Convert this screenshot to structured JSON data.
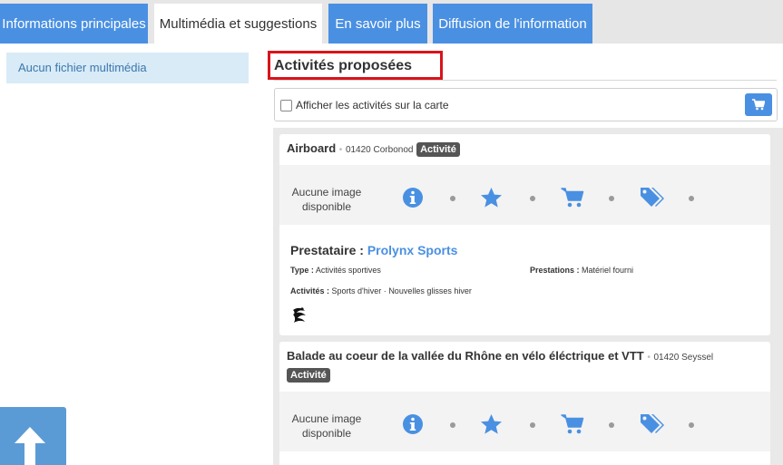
{
  "tabs": [
    {
      "label": "Informations principales"
    },
    {
      "label": "Multimédia et suggestions"
    },
    {
      "label": "En savoir plus"
    },
    {
      "label": "Diffusion de l'information"
    }
  ],
  "sidebar": {
    "media_empty": "Aucun fichier multimédia"
  },
  "section": {
    "title": "Activités proposées"
  },
  "map_toggle": {
    "label": "Afficher les activités sur la carte",
    "checked": false
  },
  "activities": [
    {
      "name": "Airboard",
      "separator": "•",
      "location": "01420 Corbonod",
      "badge": "Activité",
      "no_image": "Aucune image disponible",
      "provider_label": "Prestataire :",
      "provider_name": "Prolynx Sports",
      "type_label": "Type :",
      "type_value": "Activités sportives",
      "prestations_label": "Prestations :",
      "prestations_value": "Matériel fourni",
      "activites_label": "Activités :",
      "activites_values": [
        "Sports d'hiver",
        "Nouvelles glisses hiver"
      ],
      "activites_sep": "·"
    },
    {
      "name": "Balade au coeur de la vallée du Rhône en vélo éléctrique et VTT",
      "separator": "•",
      "location": "01420 Seyssel",
      "badge": "Activité",
      "no_image": "Aucune image disponible"
    }
  ],
  "icons": [
    "info-icon",
    "star-icon",
    "cart-icon",
    "tags-icon"
  ],
  "colors": {
    "accent": "#4a90e2",
    "highlight_border": "#d9141b",
    "badge_bg": "#555555"
  }
}
